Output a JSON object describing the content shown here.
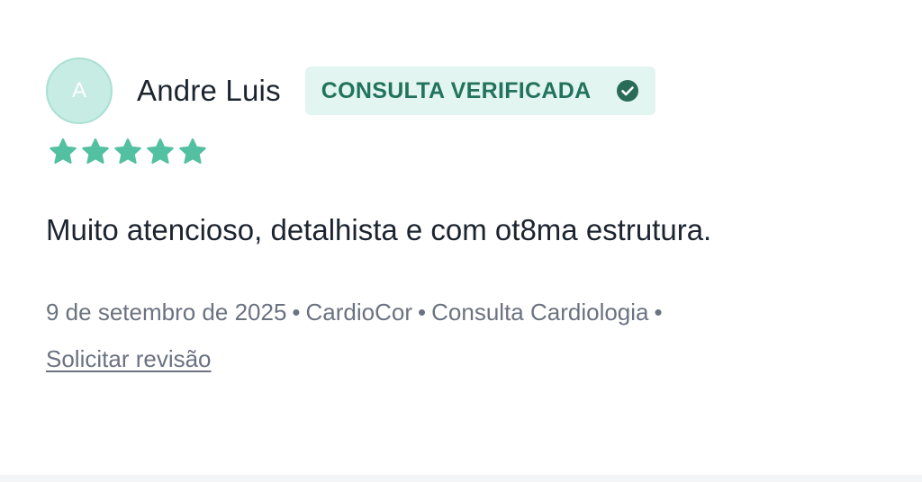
{
  "review": {
    "avatar_initial": "A",
    "author_name": "Andre Luis",
    "verified_label": "CONSULTA VERIFICADA",
    "rating": 5,
    "rating_max": 5,
    "text": "Muito atencioso, detalhista e com ot8ma estrutura.",
    "meta": {
      "date": "9 de setembro de 2025",
      "clinic": "CardioCor",
      "service": "Consulta Cardiologia",
      "separator": "•"
    },
    "request_review_label": "Solicitar revisão"
  },
  "colors": {
    "star": "#52c0a1",
    "badge_bg": "#e3f5f0",
    "badge_text": "#22735d",
    "check": "#2a6b58",
    "avatar_bg": "#c6ece3",
    "text_primary": "#1c2430",
    "text_secondary": "#6b7280"
  },
  "icons": {
    "verified": "check-circle-icon",
    "rating": "star-icon"
  }
}
